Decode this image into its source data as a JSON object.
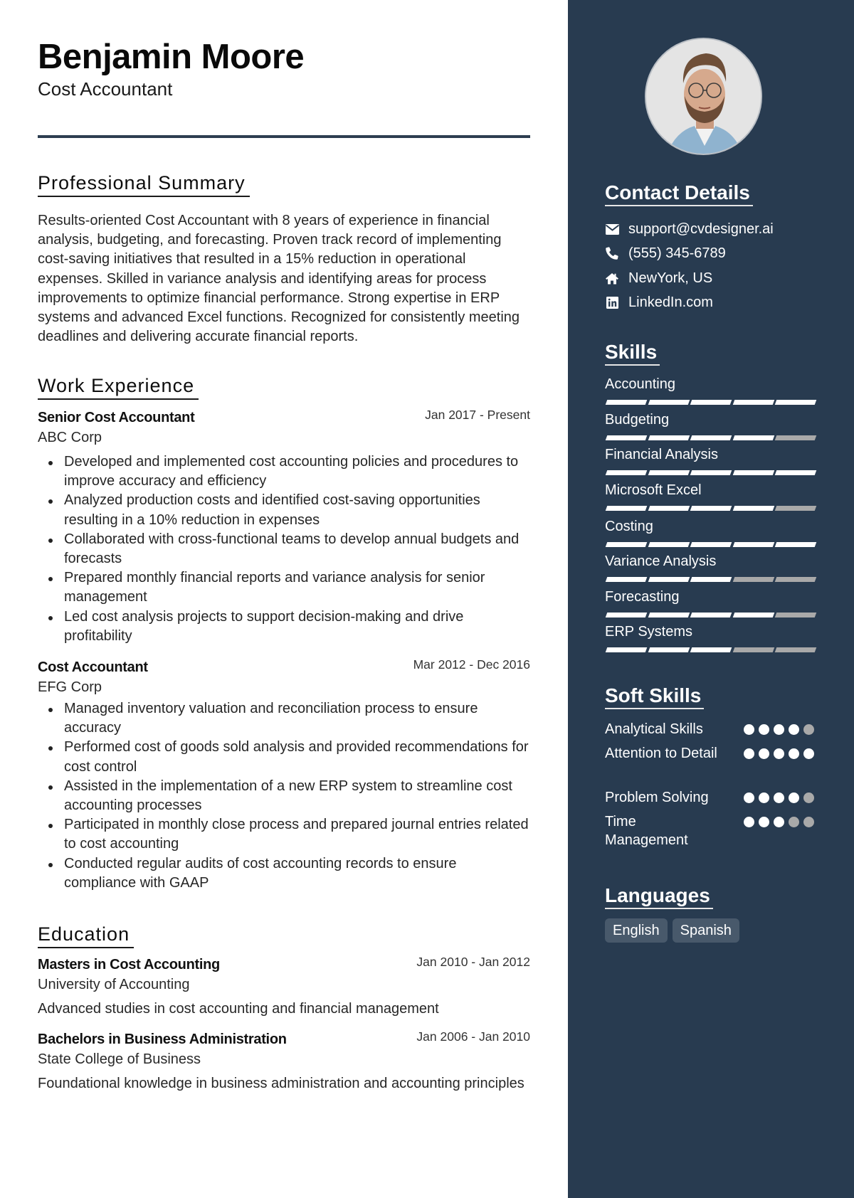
{
  "header": {
    "name": "Benjamin Moore",
    "role": "Cost Accountant"
  },
  "colors": {
    "sidebar_bg": "#283b50",
    "accent_rule": "#2d3e50",
    "skill_on": "#ffffff",
    "skill_off": "#a9a9a9",
    "language_pill_bg": "#48596b"
  },
  "summary": {
    "title": "Professional Summary",
    "text": "Results-oriented Cost Accountant with 8 years of experience in financial analysis, budgeting, and forecasting. Proven track record of implementing cost-saving initiatives that resulted in a 15% reduction in operational expenses. Skilled in variance analysis and identifying areas for process improvements to optimize financial performance. Strong expertise in ERP systems and advanced Excel functions. Recognized for consistently meeting deadlines and delivering accurate financial reports."
  },
  "experience": {
    "title": "Work Experience",
    "jobs": [
      {
        "title": "Senior Cost Accountant",
        "company": "ABC Corp",
        "dates": "Jan 2017 - Present",
        "bullets": [
          "Developed and implemented cost accounting policies and procedures to improve accuracy and efficiency",
          "Analyzed production costs and identified cost-saving opportunities resulting in a 10% reduction in expenses",
          "Collaborated with cross-functional teams to develop annual budgets and forecasts",
          "Prepared monthly financial reports and variance analysis for senior management",
          "Led cost analysis projects to support decision-making and drive profitability"
        ]
      },
      {
        "title": "Cost Accountant",
        "company": "EFG Corp",
        "dates": "Mar 2012 - Dec 2016",
        "bullets": [
          "Managed inventory valuation and reconciliation process to ensure accuracy",
          "Performed cost of goods sold analysis and provided recommendations for cost control",
          "Assisted in the implementation of a new ERP system to streamline cost accounting processes",
          "Participated in monthly close process and prepared journal entries related to cost accounting",
          "Conducted regular audits of cost accounting records to ensure compliance with GAAP"
        ]
      }
    ]
  },
  "education": {
    "title": "Education",
    "items": [
      {
        "degree": "Masters in Cost Accounting",
        "school": "University of Accounting",
        "dates": "Jan 2010 - Jan 2012",
        "description": "Advanced studies in cost accounting and financial management"
      },
      {
        "degree": "Bachelors in Business Administration",
        "school": "State College of Business",
        "dates": "Jan 2006 - Jan 2010",
        "description": "Foundational knowledge in business administration and accounting principles"
      }
    ]
  },
  "sidebar": {
    "photo_alt": "profile-photo",
    "contact": {
      "title": "Contact Details",
      "items": [
        {
          "icon": "envelope-icon",
          "text": "support@cvdesigner.ai"
        },
        {
          "icon": "phone-icon",
          "text": "(555) 345-6789"
        },
        {
          "icon": "home-icon",
          "text": "NewYork, US"
        },
        {
          "icon": "linkedin-icon",
          "text": "LinkedIn.com"
        }
      ]
    },
    "skills": {
      "title": "Skills",
      "max": 5,
      "items": [
        {
          "label": "Accounting",
          "level": 5
        },
        {
          "label": "Budgeting",
          "level": 4
        },
        {
          "label": "Financial Analysis",
          "level": 5
        },
        {
          "label": "Microsoft Excel",
          "level": 4
        },
        {
          "label": "Costing",
          "level": 5
        },
        {
          "label": "Variance Analysis",
          "level": 3
        },
        {
          "label": "Forecasting",
          "level": 4
        },
        {
          "label": "ERP Systems",
          "level": 3
        }
      ]
    },
    "soft_skills": {
      "title": "Soft Skills",
      "max": 5,
      "items": [
        {
          "label": "Analytical Skills",
          "level": 4
        },
        {
          "label": "Attention to Detail",
          "level": 5
        },
        {
          "label": "Problem Solving",
          "level": 4
        },
        {
          "label": "Time Management",
          "level": 3
        }
      ]
    },
    "languages": {
      "title": "Languages",
      "items": [
        "English",
        "Spanish"
      ]
    }
  }
}
